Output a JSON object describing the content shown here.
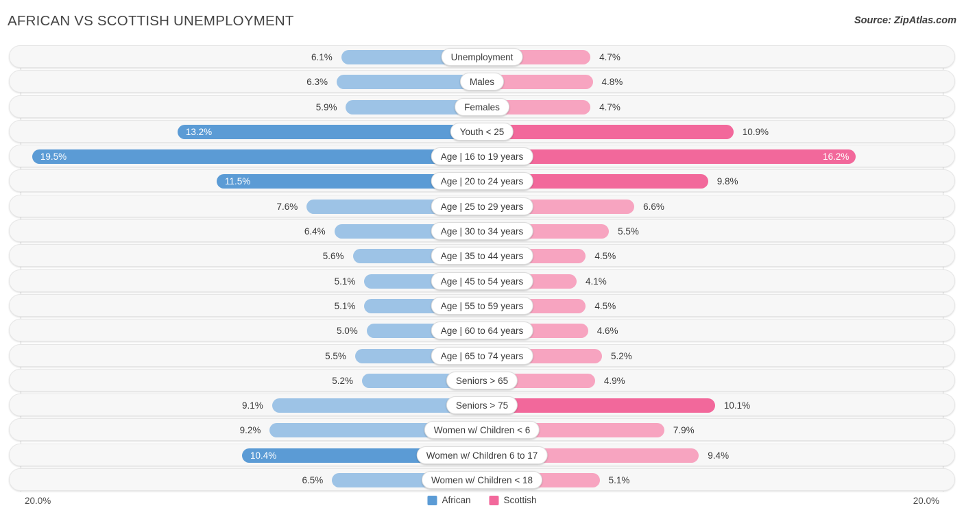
{
  "header": {
    "title": "AFRICAN VS SCOTTISH UNEMPLOYMENT",
    "source": "Source: ZipAtlas.com"
  },
  "footer": {
    "axis_left": "20.0%",
    "axis_right": "20.0%",
    "legend": [
      {
        "label": "African",
        "color": "#5b9bd5"
      },
      {
        "label": "Scottish",
        "color": "#f2689b"
      }
    ]
  },
  "colors": {
    "african_light": "#9dc3e6",
    "african_strong": "#5b9bd5",
    "scottish_light": "#f7a4c0",
    "scottish_strong": "#f2689b",
    "row_background": "#f7f7f7",
    "pill_background": "#ffffff"
  },
  "chart_data": {
    "type": "bar",
    "subtype": "diverging-bar",
    "title": "AFRICAN VS SCOTTISH UNEMPLOYMENT",
    "xlabel": "",
    "ylabel": "",
    "xlim": [
      0,
      20
    ],
    "axis_max_label": "20.0%",
    "unit": "%",
    "grid": false,
    "legend_position": "bottom-center",
    "categories": [
      "Unemployment",
      "Males",
      "Females",
      "Youth < 25",
      "Age | 16 to 19 years",
      "Age | 20 to 24 years",
      "Age | 25 to 29 years",
      "Age | 30 to 34 years",
      "Age | 35 to 44 years",
      "Age | 45 to 54 years",
      "Age | 55 to 59 years",
      "Age | 60 to 64 years",
      "Age | 65 to 74 years",
      "Seniors > 65",
      "Seniors > 75",
      "Women w/ Children < 6",
      "Women w/ Children 6 to 17",
      "Women w/ Children < 18"
    ],
    "series": [
      {
        "name": "African",
        "side": "left",
        "color": "#9dc3e6",
        "values": [
          6.1,
          6.3,
          5.9,
          13.2,
          19.5,
          11.5,
          7.6,
          6.4,
          5.6,
          5.1,
          5.1,
          5.0,
          5.5,
          5.2,
          9.1,
          9.2,
          10.4,
          6.5
        ]
      },
      {
        "name": "Scottish",
        "side": "right",
        "color": "#f7a4c0",
        "values": [
          4.7,
          4.8,
          4.7,
          10.9,
          16.2,
          9.8,
          6.6,
          5.5,
          4.5,
          4.1,
          4.5,
          4.6,
          5.2,
          4.9,
          10.1,
          7.9,
          9.4,
          5.1
        ]
      }
    ],
    "rows": [
      {
        "label": "Unemployment",
        "african": "6.1%",
        "scottish": "4.7%",
        "african_value": 6.1,
        "scottish_value": 4.7,
        "african_emphasis": false,
        "scottish_emphasis": false
      },
      {
        "label": "Males",
        "african": "6.3%",
        "scottish": "4.8%",
        "african_value": 6.3,
        "scottish_value": 4.8,
        "african_emphasis": false,
        "scottish_emphasis": false
      },
      {
        "label": "Females",
        "african": "5.9%",
        "scottish": "4.7%",
        "african_value": 5.9,
        "scottish_value": 4.7,
        "african_emphasis": false,
        "scottish_emphasis": false
      },
      {
        "label": "Youth < 25",
        "african": "13.2%",
        "scottish": "10.9%",
        "african_value": 13.2,
        "scottish_value": 10.9,
        "african_emphasis": true,
        "scottish_emphasis": true
      },
      {
        "label": "Age | 16 to 19 years",
        "african": "19.5%",
        "scottish": "16.2%",
        "african_value": 19.5,
        "scottish_value": 16.2,
        "african_emphasis": true,
        "scottish_emphasis": true
      },
      {
        "label": "Age | 20 to 24 years",
        "african": "11.5%",
        "scottish": "9.8%",
        "african_value": 11.5,
        "scottish_value": 9.8,
        "african_emphasis": true,
        "scottish_emphasis": true
      },
      {
        "label": "Age | 25 to 29 years",
        "african": "7.6%",
        "scottish": "6.6%",
        "african_value": 7.6,
        "scottish_value": 6.6,
        "african_emphasis": false,
        "scottish_emphasis": false
      },
      {
        "label": "Age | 30 to 34 years",
        "african": "6.4%",
        "scottish": "5.5%",
        "african_value": 6.4,
        "scottish_value": 5.5,
        "african_emphasis": false,
        "scottish_emphasis": false
      },
      {
        "label": "Age | 35 to 44 years",
        "african": "5.6%",
        "scottish": "4.5%",
        "african_value": 5.6,
        "scottish_value": 4.5,
        "african_emphasis": false,
        "scottish_emphasis": false
      },
      {
        "label": "Age | 45 to 54 years",
        "african": "5.1%",
        "scottish": "4.1%",
        "african_value": 5.1,
        "scottish_value": 4.1,
        "african_emphasis": false,
        "scottish_emphasis": false
      },
      {
        "label": "Age | 55 to 59 years",
        "african": "5.1%",
        "scottish": "4.5%",
        "african_value": 5.1,
        "scottish_value": 4.5,
        "african_emphasis": false,
        "scottish_emphasis": false
      },
      {
        "label": "Age | 60 to 64 years",
        "african": "5.0%",
        "scottish": "4.6%",
        "african_value": 5.0,
        "scottish_value": 4.6,
        "african_emphasis": false,
        "scottish_emphasis": false
      },
      {
        "label": "Age | 65 to 74 years",
        "african": "5.5%",
        "scottish": "5.2%",
        "african_value": 5.5,
        "scottish_value": 5.2,
        "african_emphasis": false,
        "scottish_emphasis": false
      },
      {
        "label": "Seniors > 65",
        "african": "5.2%",
        "scottish": "4.9%",
        "african_value": 5.2,
        "scottish_value": 4.9,
        "african_emphasis": false,
        "scottish_emphasis": false
      },
      {
        "label": "Seniors > 75",
        "african": "9.1%",
        "scottish": "10.1%",
        "african_value": 9.1,
        "scottish_value": 10.1,
        "african_emphasis": false,
        "scottish_emphasis": true
      },
      {
        "label": "Women w/ Children < 6",
        "african": "9.2%",
        "scottish": "7.9%",
        "african_value": 9.2,
        "scottish_value": 7.9,
        "african_emphasis": false,
        "scottish_emphasis": false
      },
      {
        "label": "Women w/ Children 6 to 17",
        "african": "10.4%",
        "scottish": "9.4%",
        "african_value": 10.4,
        "scottish_value": 9.4,
        "african_emphasis": true,
        "scottish_emphasis": false
      },
      {
        "label": "Women w/ Children < 18",
        "african": "6.5%",
        "scottish": "5.1%",
        "african_value": 6.5,
        "scottish_value": 5.1,
        "african_emphasis": false,
        "scottish_emphasis": false
      }
    ]
  }
}
